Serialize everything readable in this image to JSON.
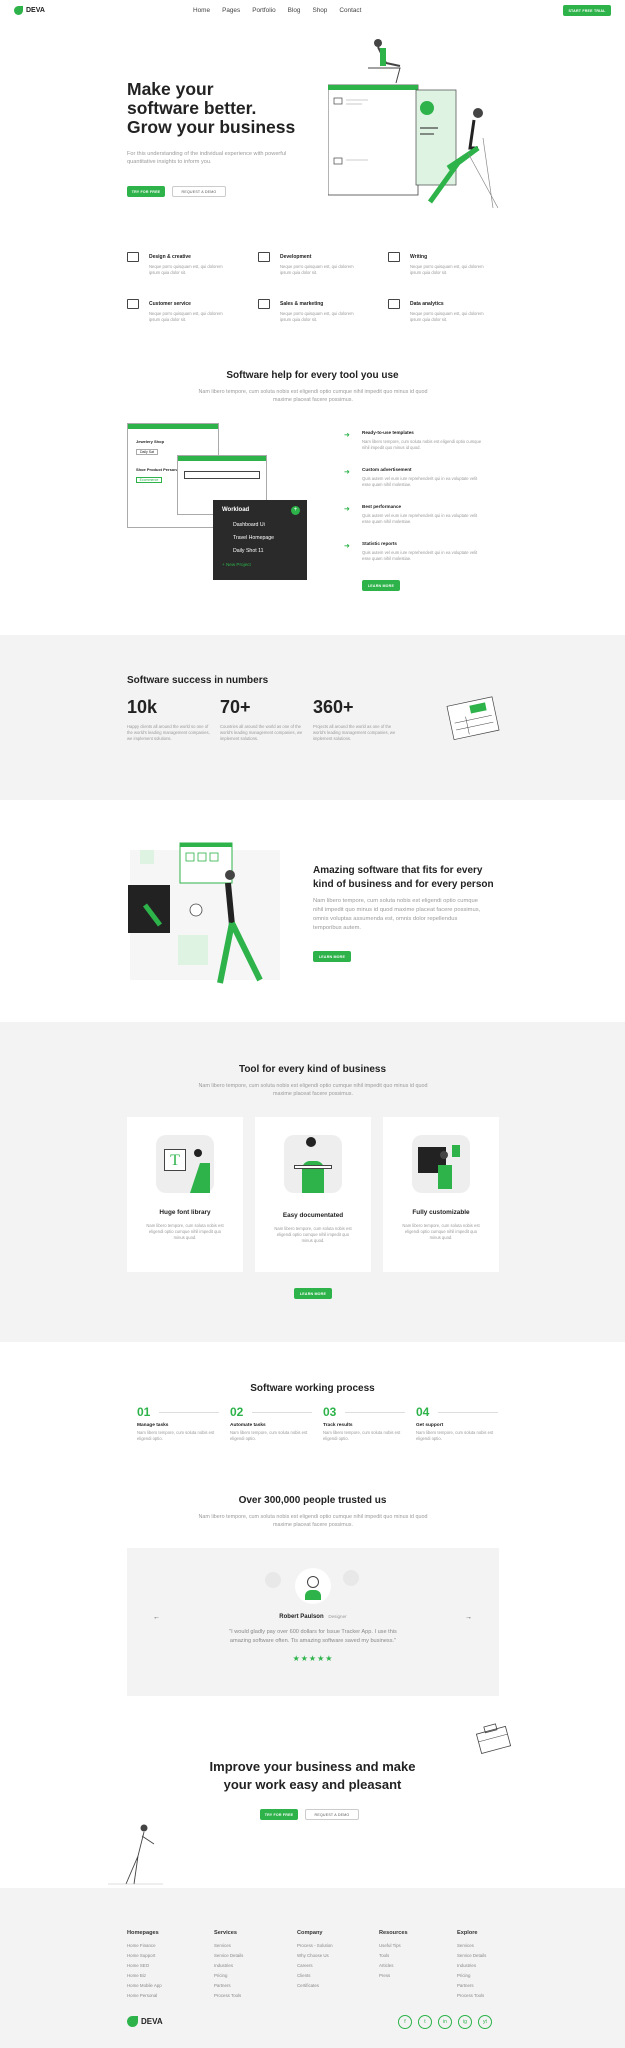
{
  "brand": {
    "name": "DEVA",
    "accent": "#2db34a"
  },
  "nav": {
    "items": [
      "Home",
      "Pages",
      "Portfolio",
      "Blog",
      "Shop",
      "Contact"
    ],
    "cta": "START FREE TRIAL"
  },
  "hero": {
    "title_line1": "Make your",
    "title_line2": "software better.",
    "title_line3": "Grow your business",
    "subtitle": "For this understanding of the individual experience with powerful quantitative insights to inform you.",
    "primary_btn": "TRY FOR FREE",
    "secondary_btn": "REQUEST A DEMO"
  },
  "features": [
    {
      "title": "Design & creative",
      "icon": "design-icon",
      "text": "Neque porro quisquam est, qui dolorem ipsum quia dolor sit."
    },
    {
      "title": "Development",
      "icon": "code-icon",
      "text": "Neque porro quisquam est, qui dolorem ipsum quia dolor sit."
    },
    {
      "title": "Writing",
      "icon": "book-icon",
      "text": "Neque porro quisquam est, qui dolorem ipsum quia dolor sit."
    },
    {
      "title": "Customer service",
      "icon": "customer-icon",
      "text": "Neque porro quisquam est, qui dolorem ipsum quia dolor sit."
    },
    {
      "title": "Sales & marketing",
      "icon": "sales-icon",
      "text": "Neque porro quisquam est, qui dolorem ipsum quia dolor sit."
    },
    {
      "title": "Data analytics",
      "icon": "analytics-icon",
      "text": "Neque porro quisquam est, qui dolorem ipsum quia dolor sit."
    }
  ],
  "help": {
    "title": "Software help for every tool you use",
    "subtitle": "Nam libero tempore, cum soluta nobis est eligendi optio cumque nihil impedit quo minus id quod maxime placeat facere possimus.",
    "list": [
      {
        "title": "Ready-to-use templates",
        "text": "Nam libero tempore, cum soluta nobis est eligendi optio cumque nihil impedit quo minus id quod."
      },
      {
        "title": "Custom advertisement",
        "text": "Quis autem vel eum iure reprehenderit qui in ea voluptate velit esse quam nihil molestiae."
      },
      {
        "title": "Best performance",
        "text": "Quis autem vel eum iure reprehenderit qui in ea voluptate velit esse quam nihil molestiae."
      },
      {
        "title": "Statistic reports",
        "text": "Quis autem vel eum iure reprehenderit qui in ea voluptate velit esse quam nihil molestiae."
      }
    ],
    "btn": "LEARN MORE",
    "mock": {
      "card1_title": "Jewelery Shop",
      "card1_btn": "Daily Sat",
      "card1_title2": "Shoe Product Personal",
      "card1_btn2": "Ecommerce",
      "card1_footer": "ONLINE DATE",
      "workload_title": "Workload",
      "workload_items": [
        "Dashboard Ui",
        "Travel Homepage",
        "Daily Shot 11"
      ],
      "workload_link": "+ New Project"
    }
  },
  "numbers": {
    "title": "Software success in numbers",
    "stats": [
      {
        "value": "10k",
        "text": "Happy clients all around the world so one of the world's leading management companies, we implement solutions."
      },
      {
        "value": "70+",
        "text": "Countries all around the world as one of the world's leading management companies, we implement solutions."
      },
      {
        "value": "360+",
        "text": "Projects all around the world as one of the world's leading management companies, we implement solutions."
      }
    ]
  },
  "amazing": {
    "title": "Amazing software that fits for every kind of business and for every person",
    "text": "Nam libero tempore, cum soluta nobis est eligendi optio cumque nihil impedit quo minus id quod maxime placeat facere possimus, omnis voluptas assumenda est, omnis dolor repellendus temporibus autem.",
    "btn": "LEARN MORE"
  },
  "tools": {
    "title": "Tool for every kind of business",
    "subtitle": "Nam libero tempore, cum soluta nobis est eligendi optio cumque nihil impedit quo minus id quod maxime placeat facere possimus.",
    "cards": [
      {
        "title": "Huge font library",
        "text": "Nam libero tempore, cum soluta nobis est eligendi optio cumque nihil impedit quo minus quod."
      },
      {
        "title": "Easy documentated",
        "text": "Nam libero tempore, cum soluta nobis est eligendi optio cumque nihil impedit quo minus quod."
      },
      {
        "title": "Fully customizable",
        "text": "Nam libero tempore, cum soluta nobis est eligendi optio cumque nihil impedit quo minus quod."
      }
    ],
    "btn": "LEARN MORE"
  },
  "process": {
    "title": "Software working process",
    "steps": [
      {
        "num": "01",
        "title": "Manage tasks",
        "text": "Nam libero tempore, cum soluta nobis est eligendi optio."
      },
      {
        "num": "02",
        "title": "Automate tasks",
        "text": "Nam libero tempore, cum soluta nobis est eligendi optio."
      },
      {
        "num": "03",
        "title": "Track results",
        "text": "Nam libero tempore, cum soluta nobis est eligendi optio."
      },
      {
        "num": "04",
        "title": "Get support",
        "text": "Nam libero tempore, cum soluta nobis est eligendi optio."
      }
    ]
  },
  "trust": {
    "title": "Over 300,000 people trusted us",
    "subtitle": "Nam libero tempore, cum soluta nobis est eligendi optio cumque nihil impedit quo minus id quod maxime placeat facere possimus.",
    "name": "Robert Paulson",
    "role": "Designer",
    "quote": "\"I would gladly pay over 600 dollars for Issue Tracker App. I use this amazing software often. Tis amazing software saved my business.\"",
    "stars": "★★★★★",
    "prev": "←",
    "next": "→"
  },
  "cta": {
    "title_line1": "Improve your business and make",
    "title_line2": "your work easy and pleasant",
    "primary_btn": "TRY FOR FREE",
    "secondary_btn": "REQUEST A DEMO"
  },
  "footer": {
    "columns": [
      {
        "title": "Homepages",
        "links": [
          "Home Finance",
          "Home Support",
          "Home SEO",
          "Home Biz",
          "Home Mobile App",
          "Home Personal"
        ]
      },
      {
        "title": "Services",
        "links": [
          "Services",
          "Service Details",
          "Industries",
          "Pricing",
          "Partners",
          "Process Tools"
        ]
      },
      {
        "title": "Company",
        "links": [
          "Process - Solution",
          "Why Choose Us",
          "Careers",
          "Clients",
          "Certificates"
        ]
      },
      {
        "title": "Resources",
        "links": [
          "Useful Tips",
          "Tools",
          "Articles",
          "Press"
        ]
      },
      {
        "title": "Explore",
        "links": [
          "Services",
          "Service Details",
          "Industries",
          "Pricing",
          "Partners",
          "Process Tools"
        ]
      }
    ],
    "brand": "DEVA",
    "social": [
      "f",
      "t",
      "in",
      "ig",
      "yt"
    ]
  }
}
